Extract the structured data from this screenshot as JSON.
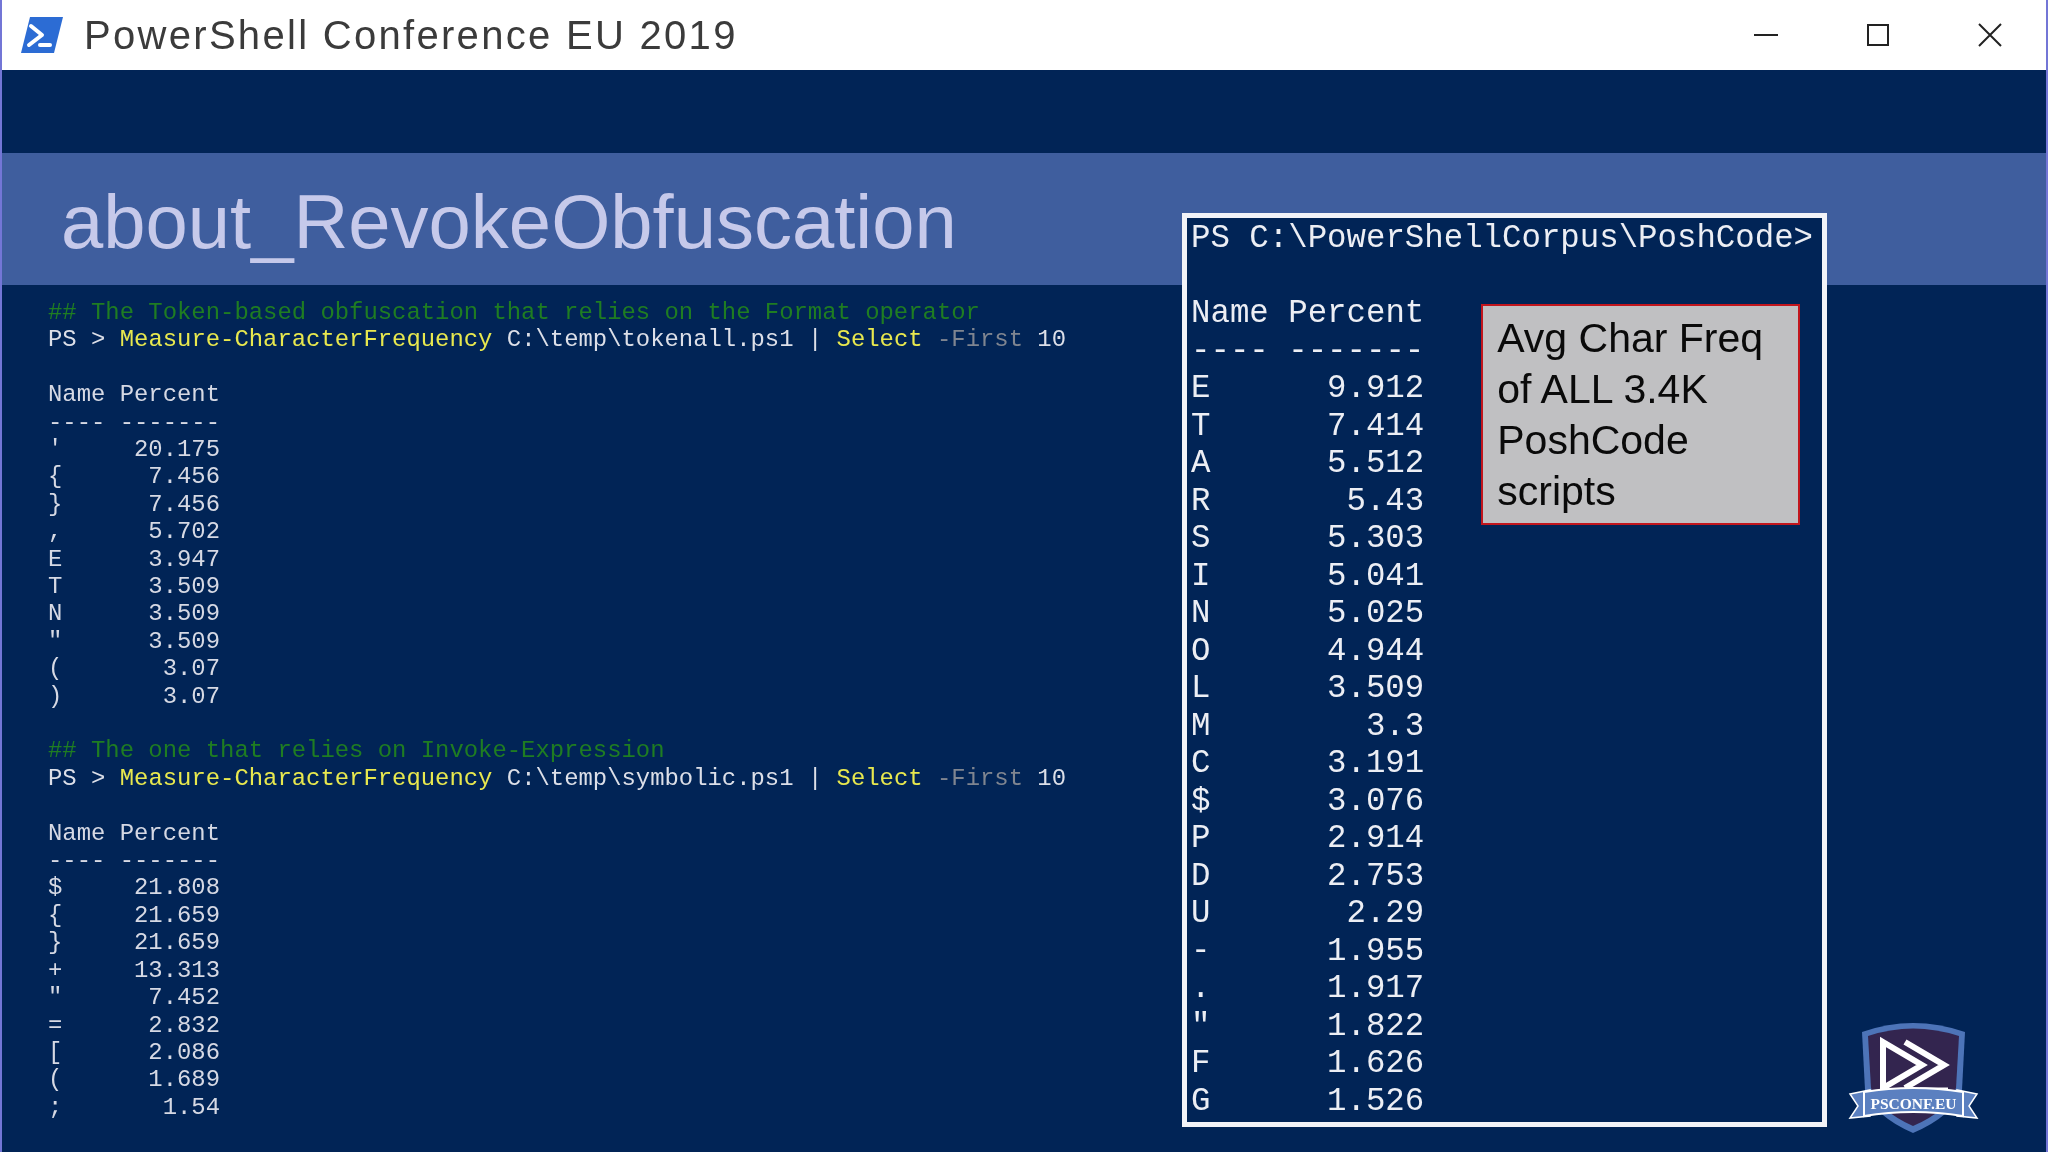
{
  "window": {
    "title": "PowerShell Conference EU 2019"
  },
  "slide": {
    "title": "about_RevokeObfuscation"
  },
  "console": {
    "blocks": [
      {
        "comment": "## The Token-based obfuscation that relies on the Format operator",
        "command": [
          {
            "kind": "prompt",
            "text": "PS >"
          },
          {
            "kind": "cmdlet",
            "text": "Measure-CharacterFrequency"
          },
          {
            "kind": "argument",
            "text": "C:\\temp\\tokenall.ps1"
          },
          {
            "kind": "operator",
            "text": "|"
          },
          {
            "kind": "cmdlet",
            "text": "Select"
          },
          {
            "kind": "parameter",
            "text": "-First"
          },
          {
            "kind": "number",
            "text": "10"
          }
        ],
        "columns": [
          "Name",
          "Percent"
        ],
        "rules": [
          "----",
          "-------"
        ],
        "rows": [
          {
            "name": "'",
            "percent": "20.175"
          },
          {
            "name": "{",
            "percent": "7.456"
          },
          {
            "name": "}",
            "percent": "7.456"
          },
          {
            "name": ",",
            "percent": "5.702"
          },
          {
            "name": "E",
            "percent": "3.947"
          },
          {
            "name": "T",
            "percent": "3.509"
          },
          {
            "name": "N",
            "percent": "3.509"
          },
          {
            "name": "\"",
            "percent": "3.509"
          },
          {
            "name": "(",
            "percent": "3.07"
          },
          {
            "name": ")",
            "percent": "3.07"
          }
        ]
      },
      {
        "comment": "## The one that relies on Invoke-Expression",
        "command": [
          {
            "kind": "prompt",
            "text": "PS >"
          },
          {
            "kind": "cmdlet",
            "text": "Measure-CharacterFrequency"
          },
          {
            "kind": "argument",
            "text": "C:\\temp\\symbolic.ps1"
          },
          {
            "kind": "operator",
            "text": "|"
          },
          {
            "kind": "cmdlet",
            "text": "Select"
          },
          {
            "kind": "parameter",
            "text": "-First"
          },
          {
            "kind": "number",
            "text": "10"
          }
        ],
        "columns": [
          "Name",
          "Percent"
        ],
        "rules": [
          "----",
          "-------"
        ],
        "rows": [
          {
            "name": "$",
            "percent": "21.808"
          },
          {
            "name": "{",
            "percent": "21.659"
          },
          {
            "name": "}",
            "percent": "21.659"
          },
          {
            "name": "+",
            "percent": "13.313"
          },
          {
            "name": "\"",
            "percent": "7.452"
          },
          {
            "name": "=",
            "percent": "2.832"
          },
          {
            "name": "[",
            "percent": "2.086"
          },
          {
            "name": "(",
            "percent": "1.689"
          },
          {
            "name": ";",
            "percent": "1.54"
          }
        ]
      }
    ]
  },
  "corpus_console": {
    "prompt": "PS C:\\PowerShellCorpus\\PoshCode>",
    "columns": [
      "Name",
      "Percent"
    ],
    "rules": [
      "----",
      "-------"
    ],
    "rows": [
      {
        "name": "E",
        "percent": "9.912"
      },
      {
        "name": "T",
        "percent": "7.414"
      },
      {
        "name": "A",
        "percent": "5.512"
      },
      {
        "name": "R",
        "percent": "5.43"
      },
      {
        "name": "S",
        "percent": "5.303"
      },
      {
        "name": "I",
        "percent": "5.041"
      },
      {
        "name": "N",
        "percent": "5.025"
      },
      {
        "name": "O",
        "percent": "4.944"
      },
      {
        "name": "L",
        "percent": "3.509"
      },
      {
        "name": "M",
        "percent": "3.3"
      },
      {
        "name": "C",
        "percent": "3.191"
      },
      {
        "name": "$",
        "percent": "3.076"
      },
      {
        "name": "P",
        "percent": "2.914"
      },
      {
        "name": "D",
        "percent": "2.753"
      },
      {
        "name": "U",
        "percent": "2.29"
      },
      {
        "name": "-",
        "percent": "1.955"
      },
      {
        "name": ".",
        "percent": "1.917"
      },
      {
        "name": "\"",
        "percent": "1.822"
      },
      {
        "name": "F",
        "percent": "1.626"
      },
      {
        "name": "G",
        "percent": "1.526"
      }
    ]
  },
  "callout": {
    "text": "Avg Char Freq of ALL 3.4K PoshCode scripts"
  },
  "logo": {
    "wordmark": "PSCONF.EU"
  }
}
